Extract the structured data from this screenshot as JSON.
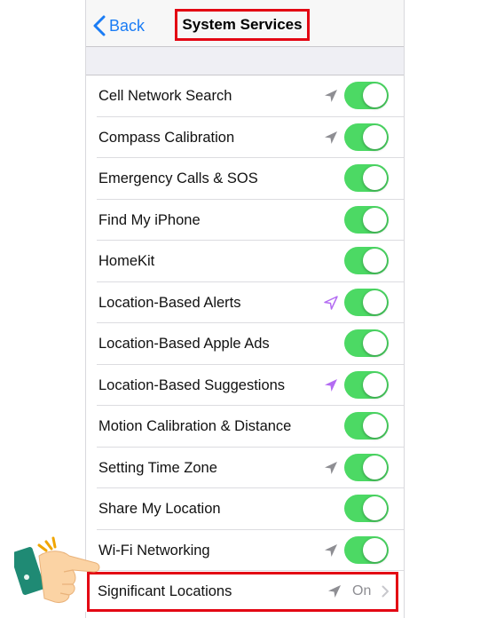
{
  "nav": {
    "back_label": "Back",
    "title": "System Services"
  },
  "items": [
    {
      "label": "Cell Network Search",
      "arrow": "gray",
      "on": true
    },
    {
      "label": "Compass Calibration",
      "arrow": "gray",
      "on": true
    },
    {
      "label": "Emergency Calls & SOS",
      "arrow": "none",
      "on": true
    },
    {
      "label": "Find My iPhone",
      "arrow": "none",
      "on": true
    },
    {
      "label": "HomeKit",
      "arrow": "none",
      "on": true
    },
    {
      "label": "Location-Based Alerts",
      "arrow": "purple-outline",
      "on": true
    },
    {
      "label": "Location-Based Apple Ads",
      "arrow": "none",
      "on": true
    },
    {
      "label": "Location-Based Suggestions",
      "arrow": "purple",
      "on": true
    },
    {
      "label": "Motion Calibration & Distance",
      "arrow": "none",
      "on": true
    },
    {
      "label": "Setting Time Zone",
      "arrow": "gray",
      "on": true
    },
    {
      "label": "Share My Location",
      "arrow": "none",
      "on": true
    },
    {
      "label": "Wi-Fi Networking",
      "arrow": "gray",
      "on": true
    }
  ],
  "significant": {
    "label": "Significant Locations",
    "value": "On",
    "arrow": "gray"
  },
  "colors": {
    "toggle_on": "#4cd964",
    "link_blue": "#1a7cf5",
    "highlight_red": "#e30613",
    "arrow_gray": "#8e8e93",
    "arrow_purple": "#b36bf2"
  },
  "icons": [
    "chevron-left-icon",
    "location-arrow-icon",
    "chevron-right-icon",
    "pointing-hand-icon"
  ]
}
